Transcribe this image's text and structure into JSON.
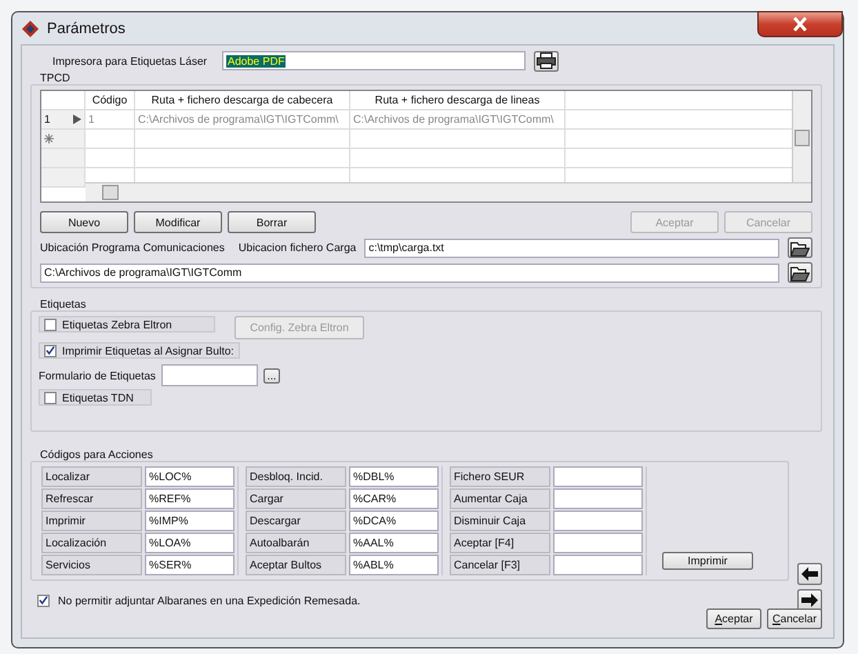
{
  "window": {
    "title": "Parámetros"
  },
  "printer": {
    "label": "Impresora para Etiquetas Láser",
    "value": "Adobe PDF"
  },
  "tpcd": {
    "title": "TPCD",
    "grid": {
      "columns": [
        "Código",
        "Ruta + fichero descarga de cabecera",
        "Ruta + fichero descarga de lineas"
      ],
      "rows": [
        {
          "number": "1",
          "current": true,
          "cells": [
            "1",
            "C:\\Archivos de programa\\IGT\\IGTComm\\",
            "C:\\Archivos de programa\\IGT\\IGTComm\\"
          ]
        }
      ]
    },
    "buttons": [
      {
        "label": "Nuevo",
        "disabled": false
      },
      {
        "label": "Modificar",
        "disabled": false
      },
      {
        "label": "Borrar",
        "disabled": false
      }
    ],
    "confirm_buttons": [
      {
        "label": "Aceptar",
        "disabled": true
      },
      {
        "label": "Cancelar",
        "disabled": true
      }
    ],
    "program_location_label": "Ubicación Programa Comunicaciones",
    "load_file_label": "Ubicacion fichero Carga",
    "load_file_value": "c:\\tmp\\carga.txt",
    "program_location_value": "C:\\Archivos de programa\\IGT\\IGTComm"
  },
  "labels": {
    "title": "Etiquetas",
    "zebra": {
      "label": "Etiquetas Zebra Eltron",
      "checked": false
    },
    "config_button": {
      "label": "Config. Zebra Eltron",
      "disabled": true
    },
    "print_on_assign": {
      "label": "Imprimir Etiquetas al Asignar Bulto:",
      "checked": true
    },
    "form_label": "Formulario de Etiquetas",
    "browse_button": "...",
    "tdn": {
      "label": "Etiquetas TDN",
      "checked": false
    }
  },
  "action_codes": {
    "title": "Códigos para Acciones",
    "columns": [
      [
        {
          "label": "Localizar",
          "value": "%LOC%"
        },
        {
          "label": "Refrescar",
          "value": "%REF%"
        },
        {
          "label": "Imprimir",
          "value": "%IMP%"
        },
        {
          "label": "Localización",
          "value": "%LOA%"
        },
        {
          "label": "Servicios",
          "value": "%SER%"
        }
      ],
      [
        {
          "label": "Desbloq. Incid.",
          "value": "%DBL%"
        },
        {
          "label": "Cargar",
          "value": "%CAR%"
        },
        {
          "label": "Descargar",
          "value": "%DCA%"
        },
        {
          "label": "Autoalbarán",
          "value": "%AAL%"
        },
        {
          "label": "Aceptar Bultos",
          "value": "%ABL%"
        }
      ],
      [
        {
          "label": "Fichero SEUR"
        },
        {
          "label": "Aumentar Caja"
        },
        {
          "label": "Disminuir Caja"
        },
        {
          "label": "Aceptar [F4]"
        },
        {
          "label": "Cancelar [F3]"
        }
      ]
    ],
    "print_button": "Imprimir"
  },
  "no_attach": {
    "label": "No permitir adjuntar Albaranes en una Expedición Remesada.",
    "checked": true
  },
  "footer_buttons": [
    {
      "label": "Aceptar"
    },
    {
      "label": "Cancelar"
    }
  ]
}
